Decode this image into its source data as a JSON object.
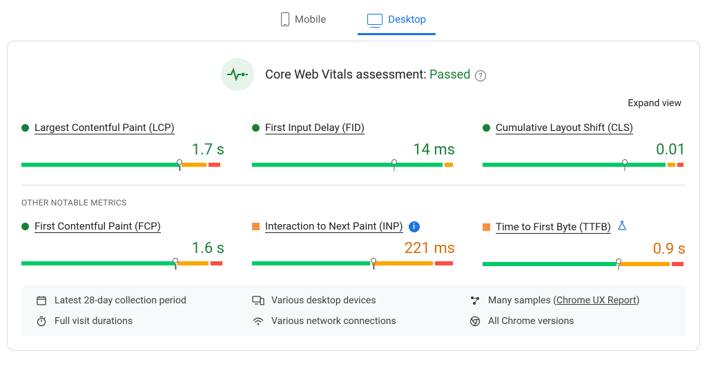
{
  "tabs": {
    "mobile": "Mobile",
    "desktop": "Desktop",
    "active": "desktop"
  },
  "assessment": {
    "label": "Core Web Vitals assessment:",
    "status": "Passed"
  },
  "controls": {
    "expand": "Expand view"
  },
  "sections": {
    "other": "OTHER NOTABLE METRICS"
  },
  "metrics": {
    "primary": [
      {
        "name": "Largest Contentful Paint (LCP)",
        "status": "green",
        "value": "1.7 s",
        "valueClass": "green",
        "dist": {
          "g": 78,
          "o": 12,
          "r": 6
        },
        "marker": 78
      },
      {
        "name": "First Input Delay (FID)",
        "status": "green",
        "value": "14 ms",
        "valueClass": "green",
        "dist": {
          "g": 94,
          "o": 4,
          "r": 0
        },
        "marker": 70
      },
      {
        "name": "Cumulative Layout Shift (CLS)",
        "status": "green",
        "value": "0.01",
        "valueClass": "green",
        "dist": {
          "g": 90,
          "o": 4,
          "r": 3
        },
        "marker": 70
      }
    ],
    "other": [
      {
        "name": "First Contentful Paint (FCP)",
        "status": "green",
        "value": "1.6 s",
        "valueClass": "green",
        "dist": {
          "g": 76,
          "o": 15,
          "r": 6
        },
        "marker": 76
      },
      {
        "name": "Interaction to Next Paint (INP)",
        "status": "orange",
        "value": "221 ms",
        "valueClass": "orange",
        "dist": {
          "g": 58,
          "o": 30,
          "r": 9
        },
        "marker": 60,
        "badge": "info"
      },
      {
        "name": "Time to First Byte (TTFB)",
        "status": "orange",
        "value": "0.9 s",
        "valueClass": "orange",
        "dist": {
          "g": 66,
          "o": 25,
          "r": 6
        },
        "marker": 67,
        "badge": "flask"
      }
    ]
  },
  "footer": {
    "period": "Latest 28-day collection period",
    "devices": "Various desktop devices",
    "samples_prefix": "Many samples (",
    "samples_link": "Chrome UX Report",
    "samples_suffix": ")",
    "durations": "Full visit durations",
    "network": "Various network connections",
    "versions": "All Chrome versions"
  }
}
